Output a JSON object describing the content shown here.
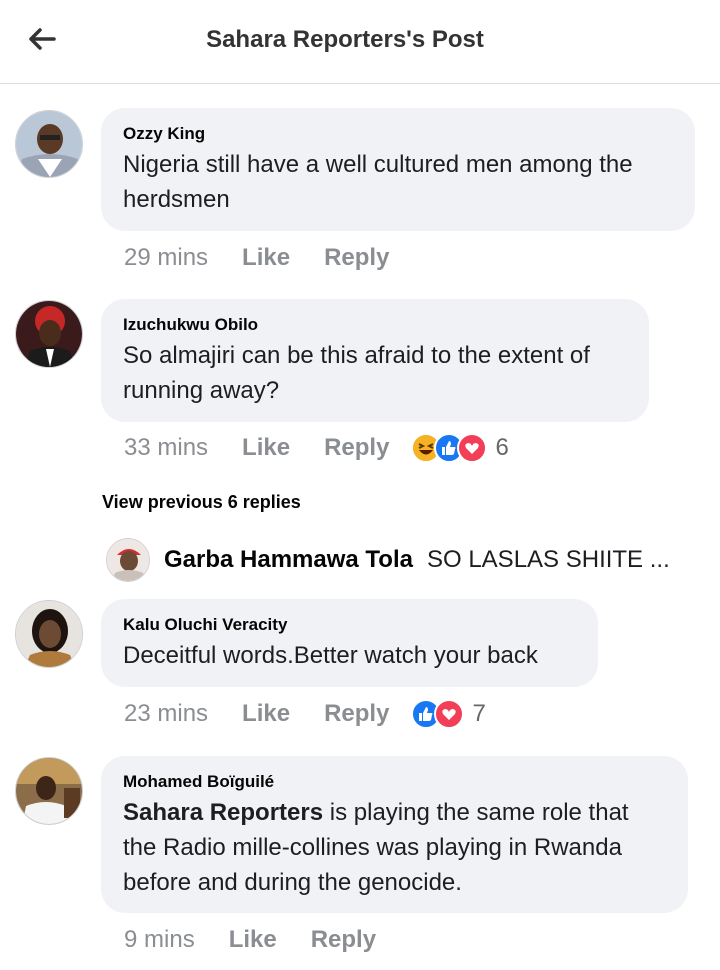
{
  "header": {
    "title": "Sahara Reporters's Post",
    "back_icon": "arrow-left-icon"
  },
  "comments": [
    {
      "author": "Ozzy King",
      "text": "Nigeria still have a well cultured men among the herdsmen",
      "time": "29 mins",
      "like": "Like",
      "reply": "Reply"
    },
    {
      "author": "Izuchukwu Obilo",
      "text": "So almajiri can be this afraid to the extent of running away?",
      "time": "33 mins",
      "like": "Like",
      "reply": "Reply",
      "reactions": [
        "haha",
        "like",
        "love"
      ],
      "reaction_count": "6"
    },
    {
      "author": "Kalu Oluchi Veracity",
      "text": "Deceitful words.Better watch your back",
      "time": "23 mins",
      "like": "Like",
      "reply": "Reply",
      "reactions": [
        "like",
        "love"
      ],
      "reaction_count": "7"
    },
    {
      "author": "Mohamed Boïguilé",
      "mention": "Sahara Reporters",
      "text": " is playing the same role  that the Radio mille-collines was playing in Rwanda before and during the genocide.",
      "time": "9 mins",
      "like": "Like",
      "reply": "Reply"
    }
  ],
  "view_previous": "View previous 6 replies",
  "reply_preview": {
    "author": "Garba Hammawa Tola",
    "text": "SO LASLAS SHIITE ..."
  },
  "colors": {
    "like_blue": "#1877f2",
    "love_red": "#f33e58",
    "haha_yellow": "#f7b125",
    "bubble_bg": "#f0f2f5",
    "meta_gray": "#8a8d91"
  }
}
